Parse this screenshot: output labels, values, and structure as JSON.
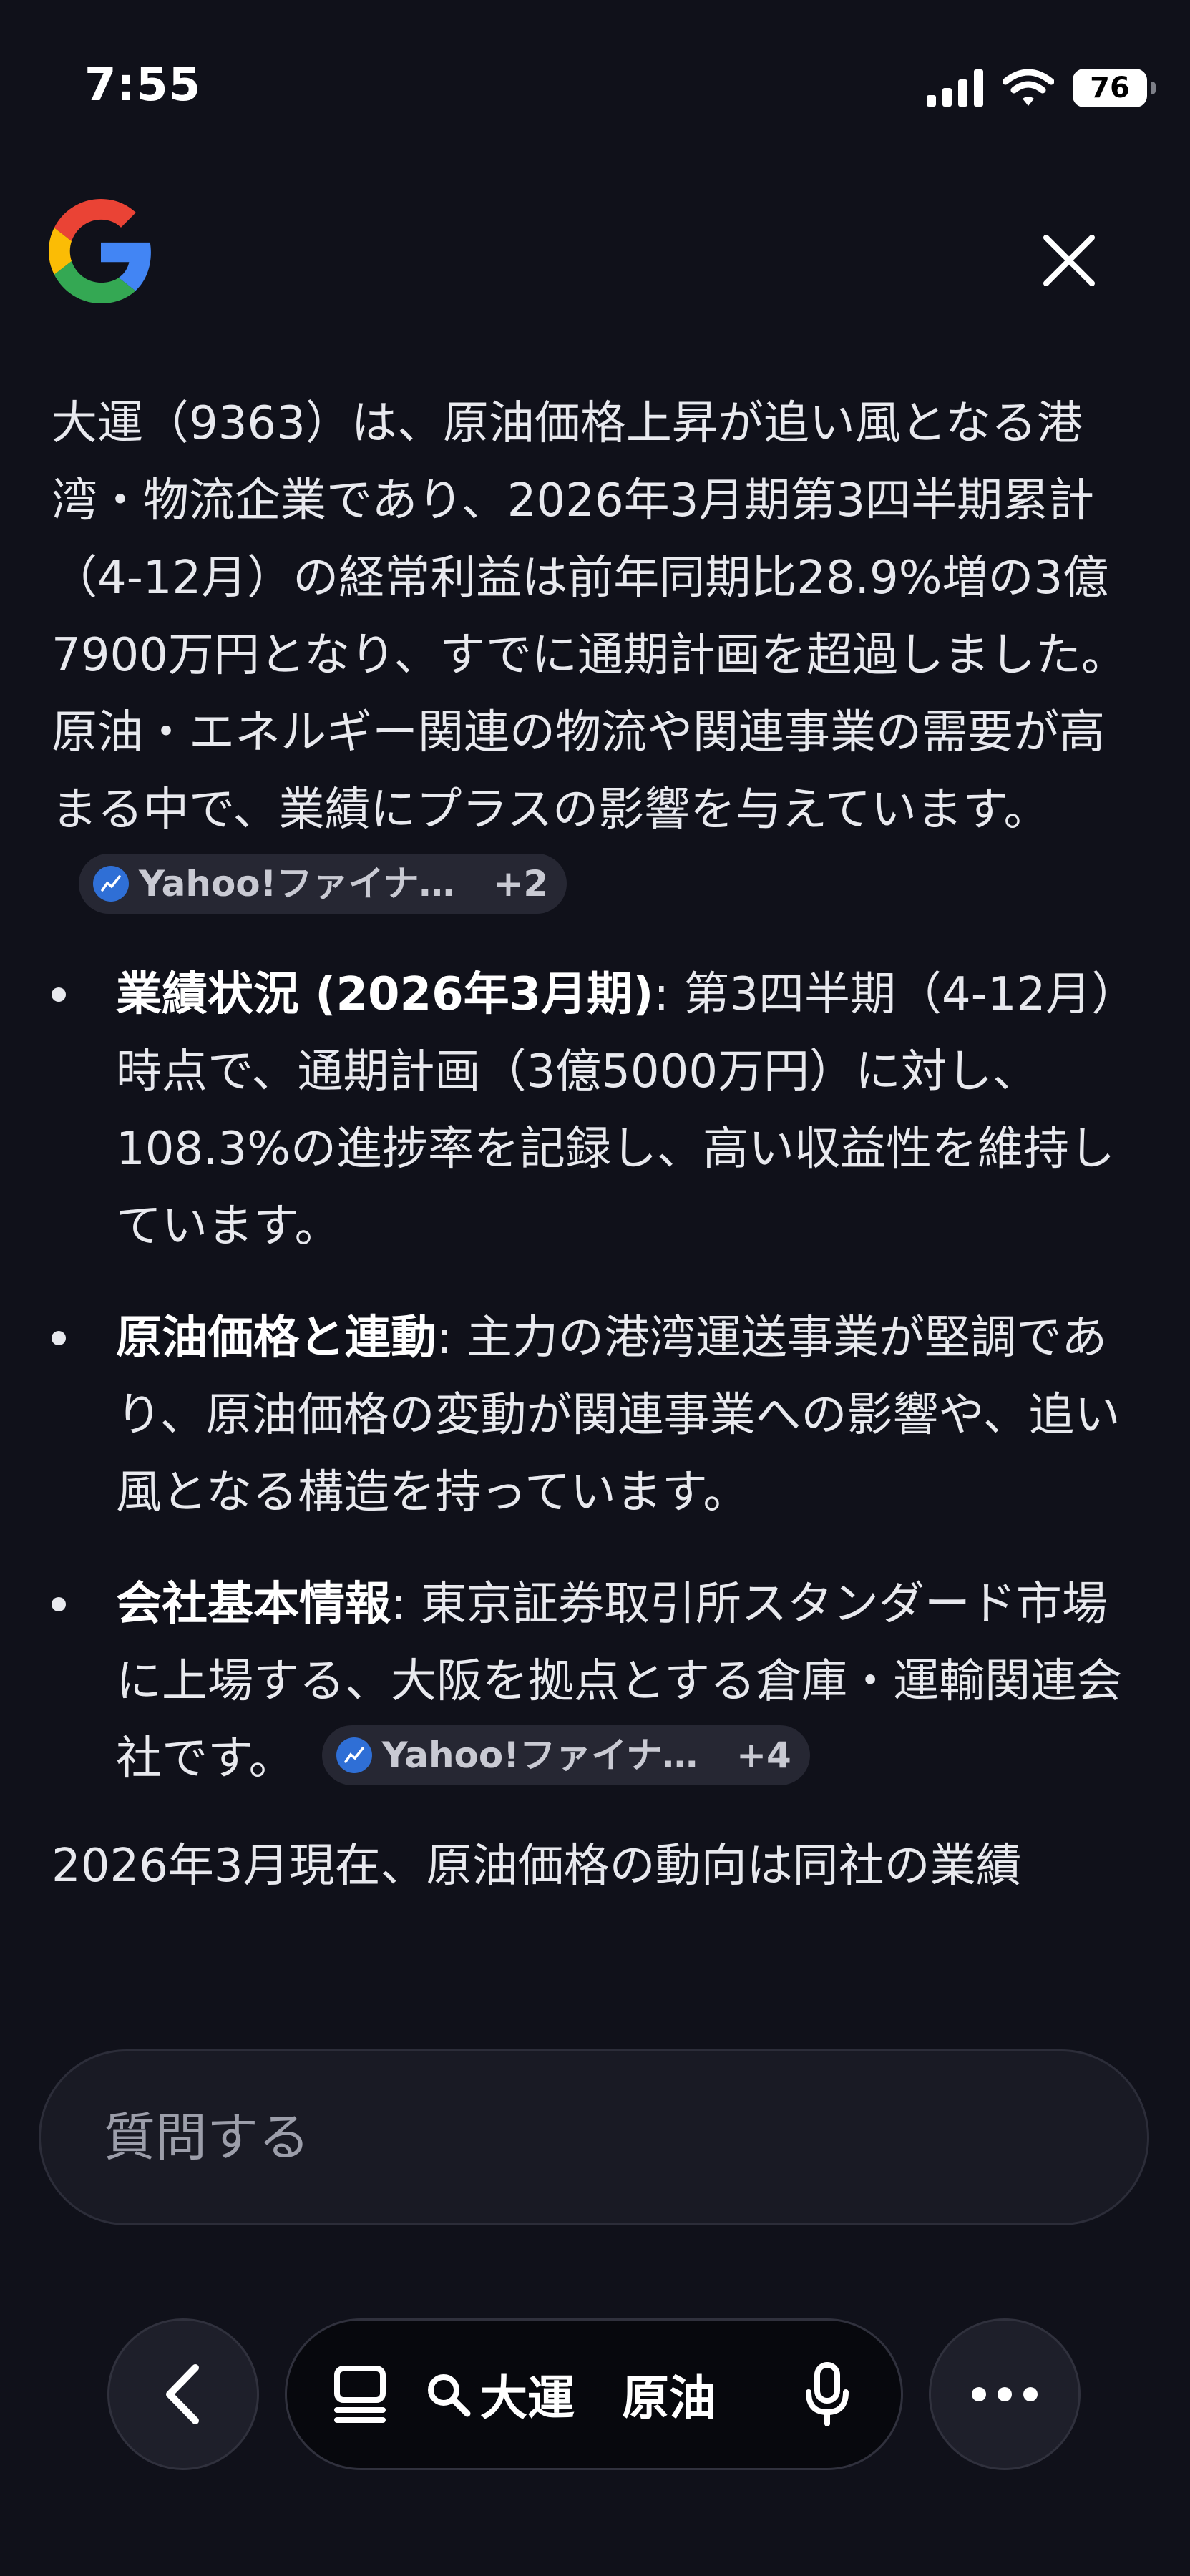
{
  "status_bar": {
    "time": "7:55",
    "battery": "76",
    "icons": [
      "signal-icon",
      "wifi-icon",
      "battery-icon"
    ]
  },
  "header": {
    "logo": "google-g-logo",
    "close_icon": "close-icon"
  },
  "answer": {
    "paragraph": "大運（9363）は、原油価格上昇が追い風となる港湾・物流企業であり、2026年3月期第3四半期累計（4-12月）の経常利益は前年同期比28.9%増の3億7900万円となり、すでに通期計画を超過しました。原油・エネルギー関連の物流や関連事業の需要が高まる中で、業績にプラスの影響を与えています。",
    "source_chip_1": {
      "label": "Yahoo!ファイナ…",
      "count": "+2"
    },
    "bullets": [
      {
        "title": "業績状況 (2026年3月期)",
        "text": ": 第3四半期（4-12月）時点で、通期計画（3億5000万円）に対し、108.3%の進捗率を記録し、高い収益性を維持しています。"
      },
      {
        "title": "原油価格と連動",
        "text": ": 主力の港湾運送事業が堅調であり、原油価格の変動が関連事業への影響や、追い風となる構造を持っています。"
      },
      {
        "title": "会社基本情報",
        "text": ": 東京証券取引所スタンダード市場に上場する、大阪を拠点とする倉庫・運輸関連会社です。"
      }
    ],
    "source_chip_2": {
      "label": "Yahoo!ファイナ…",
      "count": "+4"
    },
    "trailing_paragraph": "2026年3月現在、原油価格の動向は同社の業績"
  },
  "input": {
    "placeholder": "質問する"
  },
  "toolbar": {
    "query_terms": "大運　原油",
    "icons": [
      "back-chevron-icon",
      "tabs-icon",
      "search-icon",
      "microphone-icon",
      "more-icon"
    ]
  },
  "colors": {
    "background": "#10111a",
    "text": "#e8e9ee",
    "chip_bg": "#262733",
    "input_bg": "#191a24"
  }
}
